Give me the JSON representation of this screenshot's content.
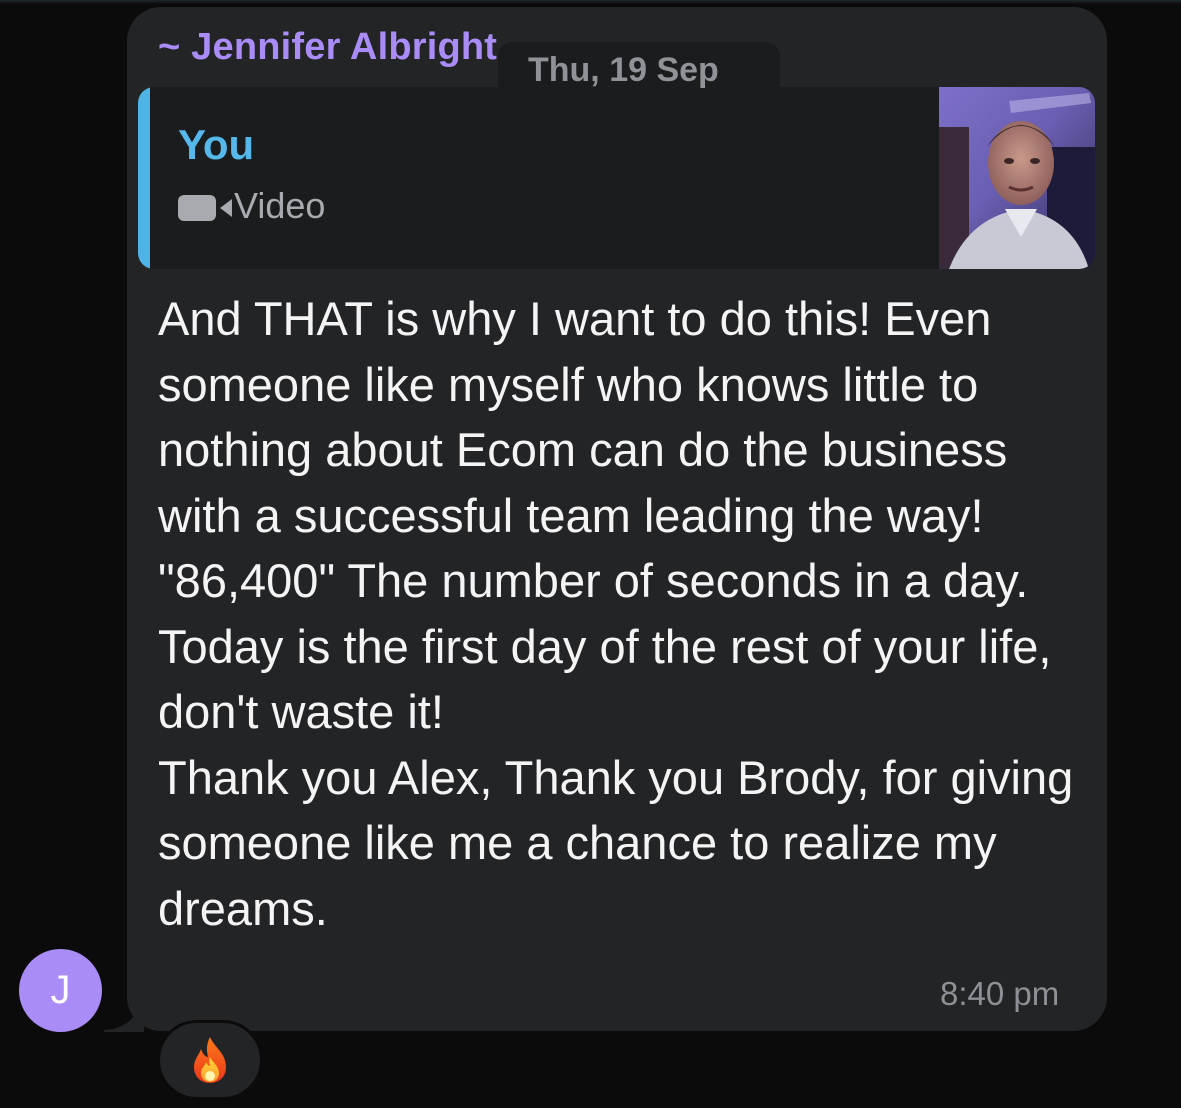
{
  "message": {
    "sender_name": "~ Jennifer Albright",
    "date_label": "Thu, 19 Sep",
    "quoted_reply": {
      "author": "You",
      "type_label": "Video",
      "icon": "video-camera-icon"
    },
    "lines": [
      "And THAT is why I want to do this! Even someone like myself who knows little to nothing about Ecom can do the business with a successful team leading the way!",
      "\"86,400\" The number of seconds in a day. Today is the first day of the rest of your life, don't waste it!",
      "Thank you Alex, Thank you Brody, for giving someone like me a chance to realize my dreams."
    ],
    "time": "8:40 pm",
    "reaction": {
      "icon": "fire-emoji"
    }
  },
  "avatar": {
    "initial": "J",
    "color": "#a98cf5"
  },
  "colors": {
    "background": "#0b0b0c",
    "bubble": "#222426",
    "sender_name": "#a98cf5",
    "quote_accent": "#4fb3e8"
  }
}
